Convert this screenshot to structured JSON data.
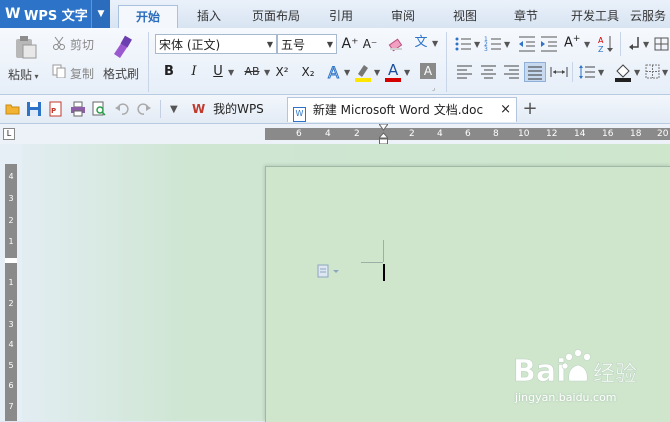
{
  "app": {
    "title": "WPS 文字",
    "logo": "W",
    "dropdown_glyph": "▼"
  },
  "menu_tabs": [
    {
      "label": "开始",
      "active": true
    },
    {
      "label": "插入"
    },
    {
      "label": "页面布局"
    },
    {
      "label": "引用"
    },
    {
      "label": "审阅"
    },
    {
      "label": "视图"
    },
    {
      "label": "章节"
    },
    {
      "label": "开发工具"
    },
    {
      "label": "云服务"
    }
  ],
  "ribbon": {
    "paste_label": "粘贴",
    "cut_label": "剪切",
    "copy_label": "复制",
    "format_painter_label": "格式刷",
    "font_name": "宋体 (正文)",
    "font_size": "五号",
    "bold": "B",
    "italic": "I",
    "underline": "U",
    "strike": "AB",
    "superscript": "X²",
    "subscript": "X₂",
    "font_color_letter": "A",
    "pinyin": "文",
    "increase_font": "A⁺",
    "decrease_font": "A⁻",
    "colors": {
      "highlight": "#ffe600",
      "font_color": "#d40000",
      "char_shade": "#808080"
    }
  },
  "quick_bar": {
    "my_wps_tab": "我的WPS",
    "doc_tab": "新建 Microsoft Word 文档.doc",
    "close_glyph": "×",
    "new_tab_glyph": "+"
  },
  "ruler": {
    "h_ticks_left": [
      "6",
      "4",
      "2"
    ],
    "h_ticks_right": [
      "2",
      "4",
      "6",
      "8",
      "10",
      "12",
      "14",
      "16",
      "18",
      "20"
    ],
    "v_ticks": [
      "4",
      "3",
      "2",
      "1",
      "1",
      "2",
      "3",
      "4",
      "5",
      "6",
      "7"
    ]
  },
  "watermark": {
    "brand": "Bai",
    "brand_suffix": "经验",
    "url": "jingyan.baidu.com"
  },
  "accent": "#2d74c8"
}
